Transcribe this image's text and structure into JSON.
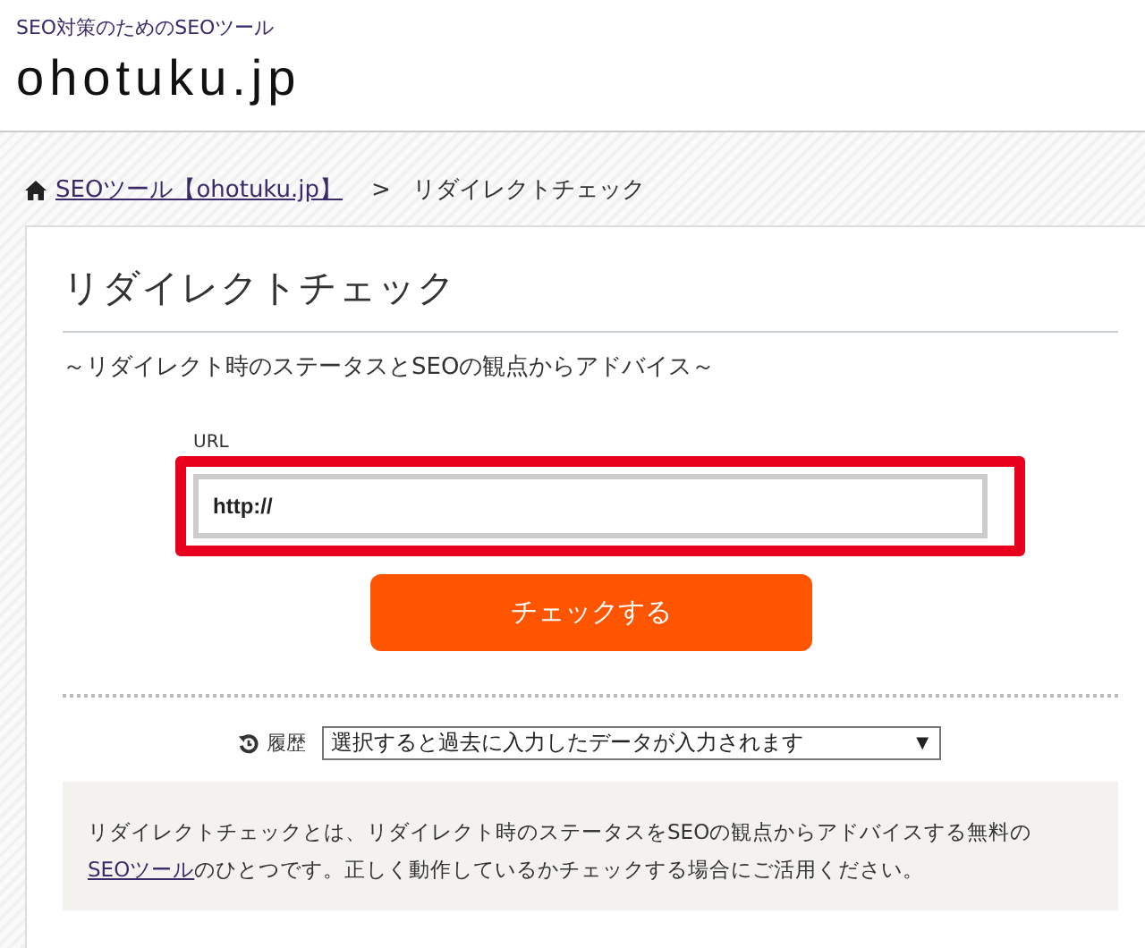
{
  "header": {
    "tagline": "SEO対策のためのSEOツール",
    "logo": "ohotuku.jp"
  },
  "breadcrumb": [
    {
      "label": "SEOツール【ohotuku.jp】",
      "kind": "link"
    },
    {
      "label": "リダイレクトチェック",
      "kind": "current"
    }
  ],
  "breadcrumb_separator": ">",
  "title": "リダイレクトチェック",
  "subtitle": "～リダイレクト時のステータスとSEOの観点からアドバイス～",
  "url_field": {
    "label": "URL",
    "value": "http://",
    "highlighted": true
  },
  "check_button": "チェックする",
  "history": {
    "label": "履歴",
    "value": "選択すると過去に入力したデータが入力されます",
    "arrow": "▼"
  },
  "description": {
    "before": "リダイレクトチェックとは、リダイレクト時のステータスをSEOの観点からアドバイスする無料の",
    "link": "SEOツール",
    "after": "のひとつです。正しく動作しているかチェックする場合にご活用ください。"
  }
}
